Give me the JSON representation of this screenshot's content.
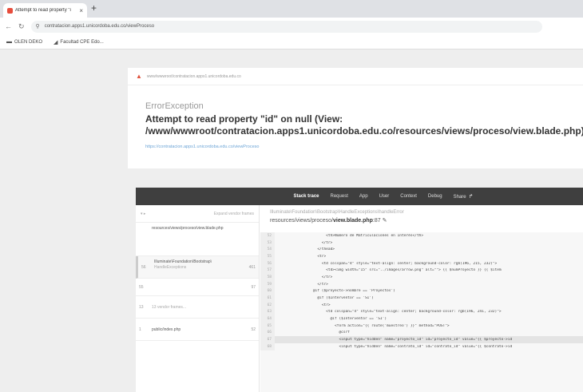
{
  "browser": {
    "tab_title": "Attempt to read property \"i",
    "tab_close": "×",
    "new_tab": "+",
    "url": "contratacion.apps1.unicordoba.edu.co/viewProceso",
    "bookmarks": [
      "OLEN DEKO",
      "Facultad CPE Edo..."
    ]
  },
  "error": {
    "top_url": "www/wwwroot/contratacion.apps1.unicordoba.edu.co",
    "exception": "ErrorException",
    "message": "Attempt to read property \"id\" on null (View: /www/wwwroot/contratacion.apps1.unicordoba.edu.co/resources/views/proceso/view.blade.php)",
    "url": "https://contratacion.apps1.unicordoba.edu.co/viewProceso"
  },
  "panel": {
    "tabs": [
      "Stack trace",
      "Request",
      "App",
      "User",
      "Context",
      "Debug",
      "Share"
    ],
    "left_header_left": "▾ ▸",
    "left_header_right": "Expand vendor frames",
    "frames": [
      {
        "num": "",
        "title": "resources/views/proceso/view.blade.php",
        "sub": "",
        "line": ""
      },
      {
        "num": "56",
        "title": "Illuminate\\Foundation\\Bootstrap\\",
        "sub": "HandleExceptions",
        "line": "461"
      },
      {
        "num": "55",
        "title": "",
        "sub": "",
        "line": "97"
      },
      {
        "num": "13",
        "title": "13 vendor frames...",
        "sub": "",
        "line": ""
      },
      {
        "num": "1",
        "title": "public/index.php",
        "sub": "",
        "line": "52"
      }
    ],
    "code_namespace": "Illuminate\\Foundation\\Bootstrap\\HandleExceptions\\handleError",
    "code_path": "resources/views/proceso/",
    "code_file": "view.blade.php",
    "code_path_suffix": ":87",
    "code_lines": [
      {
        "n": "52",
        "t": "                    <th>Número de Matriculaciones en Interés</th>"
      },
      {
        "n": "53",
        "t": "                  </tr>"
      },
      {
        "n": "54",
        "t": "                </thead>"
      },
      {
        "n": "55",
        "t": "                <tr>"
      },
      {
        "n": "56",
        "t": "                  <td colspan=\"4\" style=\"text-align: center; background-color: rgb(196, 215, 232)\">"
      },
      {
        "n": "57",
        "t": "                    <td><img width=\"15\" src=\"../images/arrow.png\" alt=\"\"> {{ $numProyecto }} {{ $item"
      },
      {
        "n": "58",
        "t": "                  </tr>"
      },
      {
        "n": "59",
        "t": "                </tr>"
      },
      {
        "n": "60",
        "t": "              @if ($proyecto->nombre == 'Proyectos')"
      },
      {
        "n": "61",
        "t": "                @if ($Interventor == 'SI')"
      },
      {
        "n": "62",
        "t": "                  <tr>"
      },
      {
        "n": "63",
        "t": "                    <td colspan=\"4\" style=\"text-align: center; background-color: rgb(196, 241, 232)\">"
      },
      {
        "n": "64",
        "t": "                      @if ($Interventor == 'SI')"
      },
      {
        "n": "65",
        "t": "                        <form action=\"{{ route('muestreo') }}\" method=\"POST\">"
      },
      {
        "n": "66",
        "t": "                          @csrf"
      },
      {
        "n": "67",
        "t": "                          <input type=\"hidden\" name=\"proyecto_id\" id=\"proyecto_id\" value=\"{{ $proyecto->id"
      },
      {
        "n": "68",
        "t": "                          <input type=\"hidden\" name=\"contrato_id\" id=\"contrato_id\" value=\"{{ $contrato->id"
      }
    ]
  }
}
